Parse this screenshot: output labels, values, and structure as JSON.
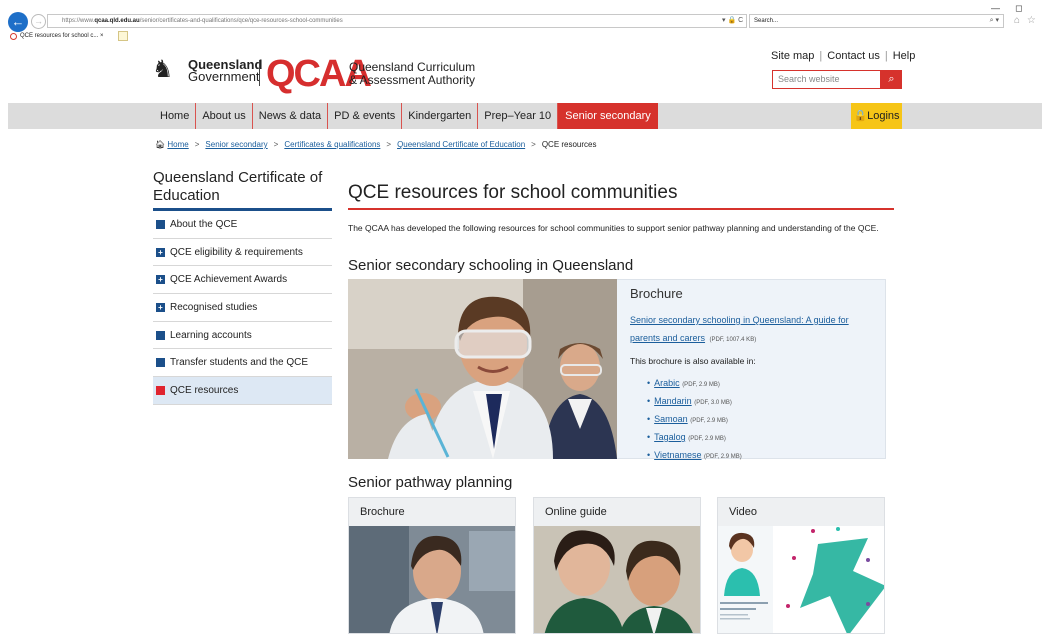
{
  "browser": {
    "url_prefix": "https://www.",
    "url_domain": "qcaa.qld.edu.au",
    "url_path": "/senior/certificates-and-qualifications/qce/qce-resources-school-communities",
    "addr_controls": "▾ 🔒 C",
    "search_placeholder": "Search...",
    "search_glass": "⌕ ▾",
    "tab_title": "QCE resources for school c... ×",
    "win_min": "—",
    "win_max": "◻",
    "home_star": "⌂ ☆"
  },
  "header": {
    "gov_line1": "Queensland",
    "gov_line2": "Government",
    "qcaa_logo": "QCAA",
    "qcaa_name1": "Queensland Curriculum",
    "qcaa_name2": "& Assessment Authority",
    "links": [
      "Site map",
      "Contact us",
      "Help"
    ],
    "search_placeholder": "Search website"
  },
  "nav": {
    "items": [
      "Home",
      "About us",
      "News & data",
      "PD & events",
      "Kindergarten",
      "Prep–Year 10",
      "Senior secondary"
    ],
    "logins": "🔒Logins"
  },
  "breadcrumb": {
    "home": "Home",
    "items": [
      "Senior secondary",
      "Certificates & qualifications",
      "Queensland Certificate of Education"
    ],
    "current": "QCE resources",
    "sep": ">"
  },
  "sidebar": {
    "title": "Queensland Certificate of Education",
    "items": [
      {
        "label": "About the QCE",
        "mark": ""
      },
      {
        "label": "QCE eligibility & requirements",
        "mark": "+"
      },
      {
        "label": "QCE Achievement Awards",
        "mark": "+"
      },
      {
        "label": "Recognised studies",
        "mark": "+"
      },
      {
        "label": "Learning accounts",
        "mark": ""
      },
      {
        "label": "Transfer students and the QCE",
        "mark": ""
      },
      {
        "label": "QCE resources",
        "mark": ""
      }
    ]
  },
  "main": {
    "title": "QCE resources for school communities",
    "intro": "The QCAA has developed the following resources for school communities to support senior pathway planning and understanding of the QCE.",
    "section1": {
      "heading": "Senior secondary schooling in Queensland",
      "box_heading": "Brochure",
      "link": "Senior secondary schooling in Queensland: A guide for parents and carers",
      "link_meta": "(PDF, 1007.4 KB)",
      "also": "This brochure is also available in:",
      "languages": [
        {
          "name": "Arabic",
          "meta": "(PDF, 2.9 MB)"
        },
        {
          "name": "Mandarin",
          "meta": "(PDF, 3.0 MB)"
        },
        {
          "name": "Samoan",
          "meta": "(PDF, 2.9 MB)"
        },
        {
          "name": "Tagalog",
          "meta": "(PDF, 2.9 MB)"
        },
        {
          "name": "Vietnamese",
          "meta": "(PDF, 2.9 MB)"
        }
      ]
    },
    "section2": {
      "heading": "Senior pathway planning",
      "cards": [
        "Brochure",
        "Online guide",
        "Video"
      ]
    }
  },
  "colors": {
    "qcaa_red": "#d6322c",
    "qld_blue": "#1b4f8a",
    "logins_yellow": "#f6c517",
    "link_blue": "#1b5e9c"
  }
}
